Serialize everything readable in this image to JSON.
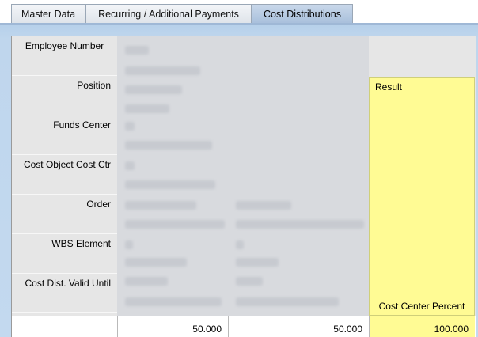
{
  "tabs": [
    {
      "label": "Master Data",
      "active": false
    },
    {
      "label": "Recurring / Additional Payments",
      "active": false
    },
    {
      "label": "Cost Distributions",
      "active": true
    }
  ],
  "labels": {
    "employee_number": "Employee Number",
    "position": "Position",
    "funds_center": "Funds Center",
    "cost_object": "Cost Object Cost Ctr",
    "order": "Order",
    "wbs": "WBS Element",
    "valid_until": "Cost Dist. Valid Until"
  },
  "result": {
    "title": "Result",
    "footer": "Cost Center Percent"
  },
  "totals": {
    "col1": "50.000",
    "col2": "50.000",
    "col3": "100.000"
  }
}
